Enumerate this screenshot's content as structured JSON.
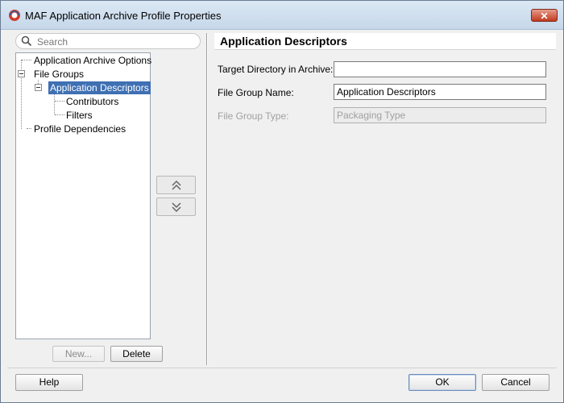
{
  "window": {
    "title": "MAF Application Archive Profile Properties",
    "close_label": "✕"
  },
  "search": {
    "placeholder": "Search",
    "value": ""
  },
  "tree": {
    "items": [
      {
        "label": "Application Archive Options"
      },
      {
        "label": "File Groups"
      },
      {
        "label": "Application Descriptors",
        "selected": true
      },
      {
        "label": "Contributors"
      },
      {
        "label": "Filters"
      },
      {
        "label": "Profile Dependencies"
      }
    ]
  },
  "tree_buttons": {
    "new_label": "New...",
    "delete_label": "Delete"
  },
  "move_buttons": {
    "up_icon": "double-chevron-up-icon",
    "down_icon": "double-chevron-down-icon"
  },
  "section": {
    "title": "Application Descriptors"
  },
  "form": {
    "target_dir_label": "Target Directory in Archive:",
    "target_dir_value": "",
    "file_group_name_label": "File Group Name:",
    "file_group_name_value": "Application Descriptors",
    "file_group_type_label": "File Group Type:",
    "file_group_type_value": "Packaging Type"
  },
  "footer": {
    "help_label": "Help",
    "ok_label": "OK",
    "cancel_label": "Cancel"
  },
  "colors": {
    "selection": "#3f70b3",
    "close_button": "#c23a1e",
    "title_bar": "#c5d7ea"
  }
}
